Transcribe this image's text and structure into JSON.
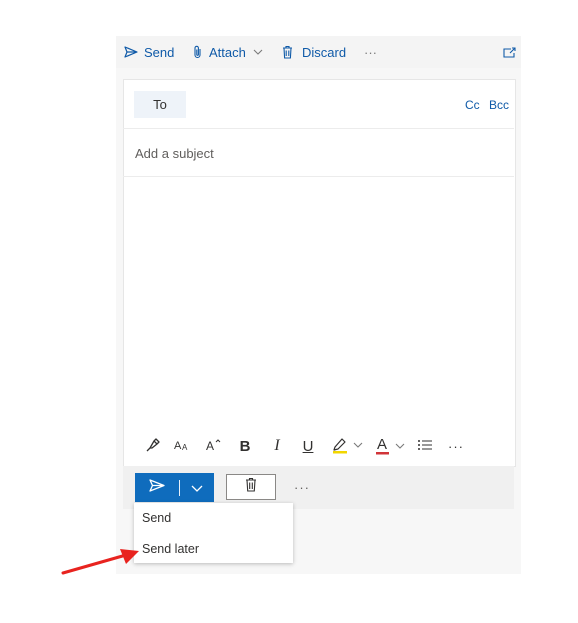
{
  "toolbar": {
    "send_label": "Send",
    "attach_label": "Attach",
    "discard_label": "Discard",
    "more_label": "···",
    "icons": [
      "send-icon",
      "paperclip-icon",
      "chevron-down-icon",
      "trash-icon",
      "popout-icon"
    ]
  },
  "compose": {
    "to_label": "To",
    "cc_label": "Cc",
    "bcc_label": "Bcc",
    "subject_placeholder": "Add a subject",
    "body_text": ""
  },
  "format_toolbar": {
    "bold_label": "B",
    "italic_label": "I",
    "underline_label": "U",
    "font_color_label": "A",
    "more_label": "···",
    "icons": [
      "format-painter-icon",
      "font-size-icon",
      "grow-font-icon",
      "highlight-icon",
      "font-color-icon",
      "bullets-icon"
    ]
  },
  "actions": {
    "more_label": "···"
  },
  "send_menu": {
    "items": [
      {
        "label": "Send"
      },
      {
        "label": "Send later"
      }
    ]
  },
  "colors": {
    "accent": "#0f6cbd",
    "link": "#0f5aa8",
    "highlight": "#f2d600",
    "font_color_underline": "#d13438",
    "annotation_arrow": "#e8231f"
  }
}
